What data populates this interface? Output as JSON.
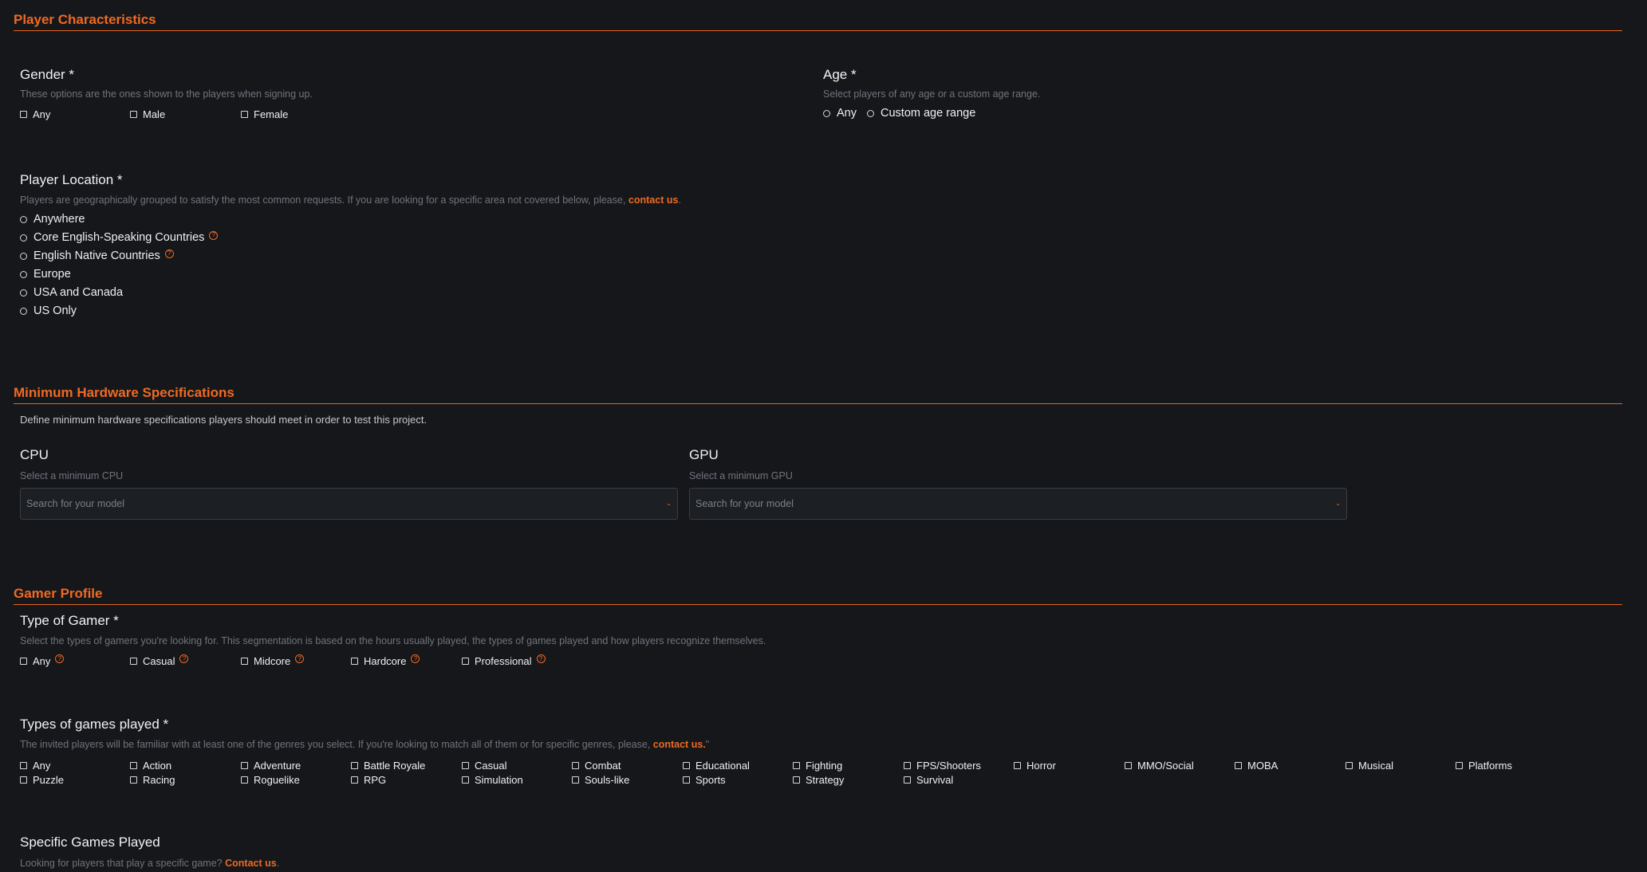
{
  "sections": {
    "player": "Player Characteristics",
    "hardware": "Minimum Hardware Specifications",
    "gamer": "Gamer Profile"
  },
  "gender": {
    "title": "Gender *",
    "help": "These options are the ones shown to the players when signing up.",
    "options": [
      "Any",
      "Male",
      "Female"
    ]
  },
  "age": {
    "title": "Age *",
    "help": "Select players of any age or a custom age range.",
    "options": [
      "Any",
      "Custom age range"
    ]
  },
  "location": {
    "title": "Player Location *",
    "help": "Players are geographically grouped to satisfy the most common requests. If you are looking for a specific area not covered below, please,",
    "link": "contact us",
    "after": ".",
    "options": [
      "Anywhere",
      "Core English-Speaking Countries",
      "English Native Countries",
      "Europe",
      "USA and Canada",
      "US Only"
    ]
  },
  "hardware": {
    "description": "Define minimum hardware specifications players should meet in order to test this project.",
    "cpu": {
      "title": "CPU",
      "help": "Select a minimum CPU",
      "placeholder": "Search for your model"
    },
    "gpu": {
      "title": "GPU",
      "help": "Select a minimum GPU",
      "placeholder": "Search for your model"
    }
  },
  "gamer_type": {
    "title": "Type of Gamer *",
    "help": "Select the types of gamers you're looking for. This segmentation is based on the hours usually played, the types of games played and how players recognize themselves.",
    "options": [
      "Any",
      "Casual",
      "Midcore",
      "Hardcore",
      "Professional"
    ]
  },
  "games_played": {
    "title": "Types of games played *",
    "help": "The invited players will be familiar with at least one of the genres you select. If you're looking to match all of them or for specific genres, please,",
    "link": "contact us.",
    "after": "\"",
    "genres": [
      "Any",
      "Action",
      "Adventure",
      "Battle Royale",
      "Casual",
      "Combat",
      "Educational",
      "Fighting",
      "FPS/Shooters",
      "Horror",
      "MMO/Social",
      "MOBA",
      "Musical",
      "Platforms",
      "Puzzle",
      "Racing",
      "Roguelike",
      "RPG",
      "Simulation",
      "Souls-like",
      "Sports",
      "Strategy",
      "Survival"
    ]
  },
  "specific_games": {
    "title": "Specific Games Played",
    "help": "Looking for players that play a specific game?",
    "link": "Contact us",
    "after": "."
  },
  "icons": {
    "help": "question-circle-icon",
    "caret": "chevron-down-icon"
  },
  "colors": {
    "accent": "#ef6a22",
    "background": "#15171b"
  }
}
